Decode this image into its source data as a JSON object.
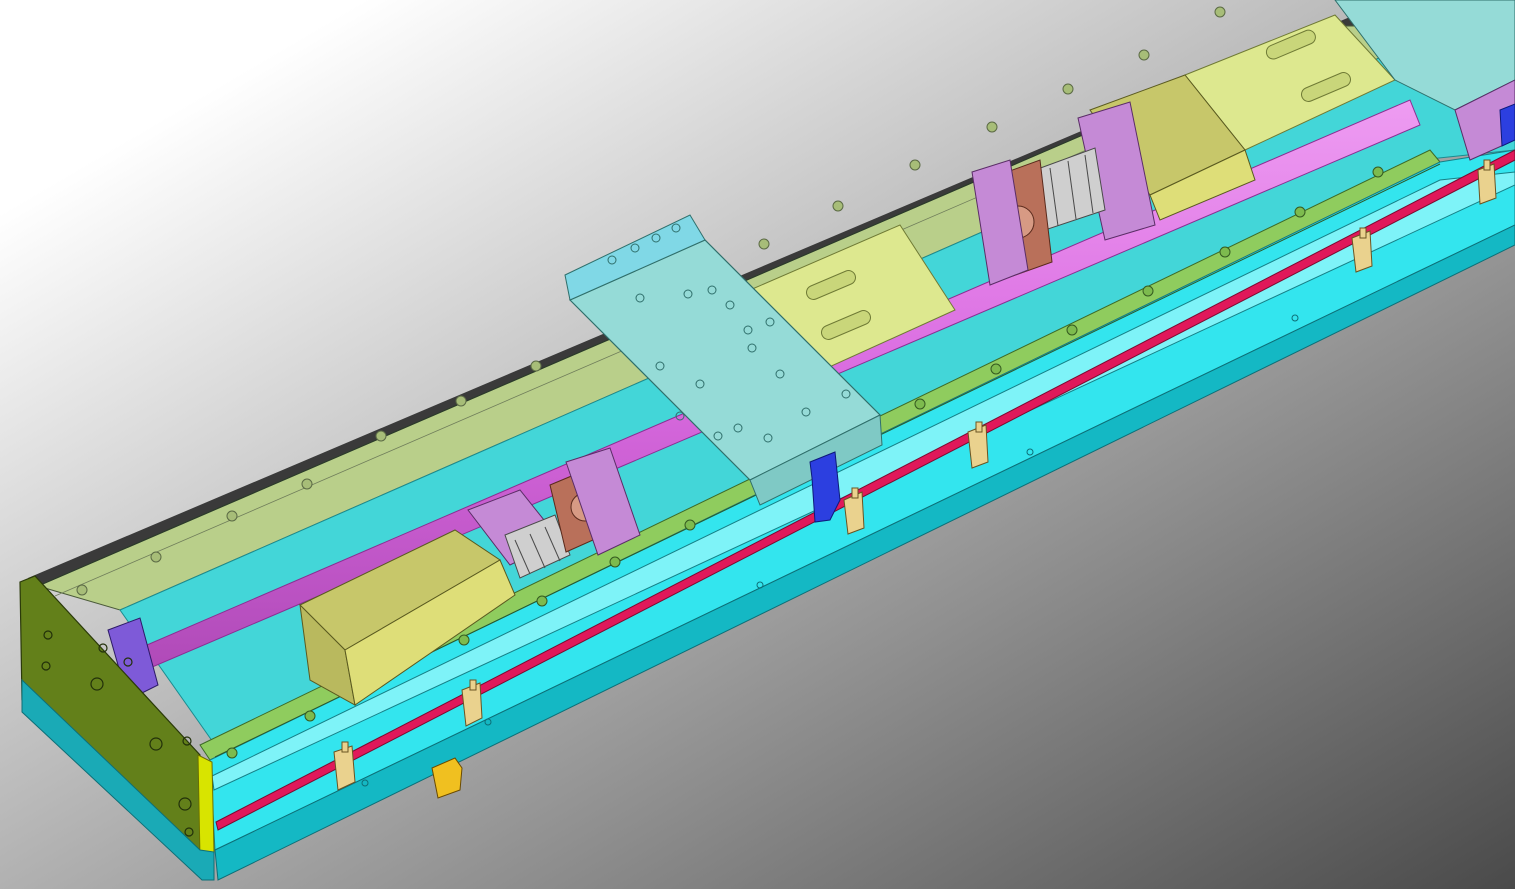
{
  "viewport": {
    "background": {
      "top_left": "#ffffff",
      "bottom_right": "#4a4a4a"
    }
  },
  "colors": {
    "frame_cyan": "#33e5ee",
    "frame_cyan_dark": "#14b8c4",
    "frame_cyan_light": "#7ef3f8",
    "interior_cyan": "#43d6d8",
    "end_plate": "#63801a",
    "end_plate_edge": "#d8e400",
    "top_rail_green": "#b9cf8a",
    "front_rail_green": "#8fcc5e",
    "ballscrew_magenta": "#d96ae0",
    "motor_yellow": "#dede78",
    "mount_purple": "#c58ad6",
    "bearing_brown": "#b9705a",
    "sensor_strip_red": "#e0185a",
    "carriage_plate": "#95dbd7",
    "slider_block": "#dde88f",
    "sensor_bracket": "#ead28e",
    "connector_blue": "#2c3fe0",
    "cable_connector": "#f0c020"
  },
  "parts": [
    {
      "name": "frame-base",
      "shape": "long-box"
    },
    {
      "name": "end-plate",
      "shape": "plate-with-holes"
    },
    {
      "name": "linear-guide-top",
      "shape": "rail"
    },
    {
      "name": "linear-guide-front",
      "shape": "rail"
    },
    {
      "name": "ball-screw",
      "shape": "cylinder"
    },
    {
      "name": "servo-motor",
      "shape": "box",
      "count": 2
    },
    {
      "name": "bearing-support",
      "shape": "block",
      "count": 2
    },
    {
      "name": "coupling",
      "shape": "cylinder",
      "count": 2
    },
    {
      "name": "carriage-plate",
      "shape": "plate-with-holes"
    },
    {
      "name": "slider-block",
      "shape": "plate-with-slots",
      "count": 2
    },
    {
      "name": "sensor-strip",
      "shape": "strip"
    },
    {
      "name": "limit-sensor-bracket",
      "shape": "bracket",
      "count": 8
    },
    {
      "name": "cable-connector",
      "shape": "clamp"
    }
  ]
}
